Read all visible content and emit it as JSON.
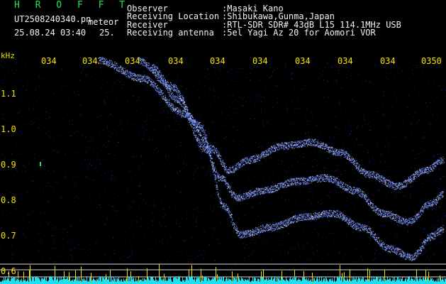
{
  "header": {
    "title": "H R O F F T",
    "filename": "UT2508240340.pn",
    "label_meteor": "meteor",
    "datetime": "25.08.24 03:40",
    "frame_num": "25."
  },
  "info": [
    {
      "label": "Observer",
      "value": ":Masaki Kano"
    },
    {
      "label": "Receiving Location",
      "value": ":Shibukawa,Gunma,Japan"
    },
    {
      "label": "Receiver",
      "value": ":RTL-SDR SDR# 43dB L15 114.1MHz USB"
    },
    {
      "label": "Receiving antenna",
      "value": ":5el Yagi Az 20 for Aomori VOR"
    }
  ],
  "axes": {
    "unit": "kHz",
    "time_ticks": [
      "034",
      "0342",
      "034",
      "034",
      "034",
      "034",
      "034",
      "034",
      "034",
      "0350"
    ],
    "freq_ticks": [
      "1.1",
      "1.0",
      "0.9",
      "0.8",
      "0.7",
      "0.6"
    ]
  },
  "colors": {
    "background": "#000000",
    "text_white": "#f2f2f2",
    "text_green": "#22e05a",
    "text_yellow": "#f2e200",
    "noise_blue": "#1a2a9e",
    "signal_blue": "#6d8cff",
    "baseline_cyan": "#20e0f0",
    "spike_yellow": "#f2e200"
  }
}
